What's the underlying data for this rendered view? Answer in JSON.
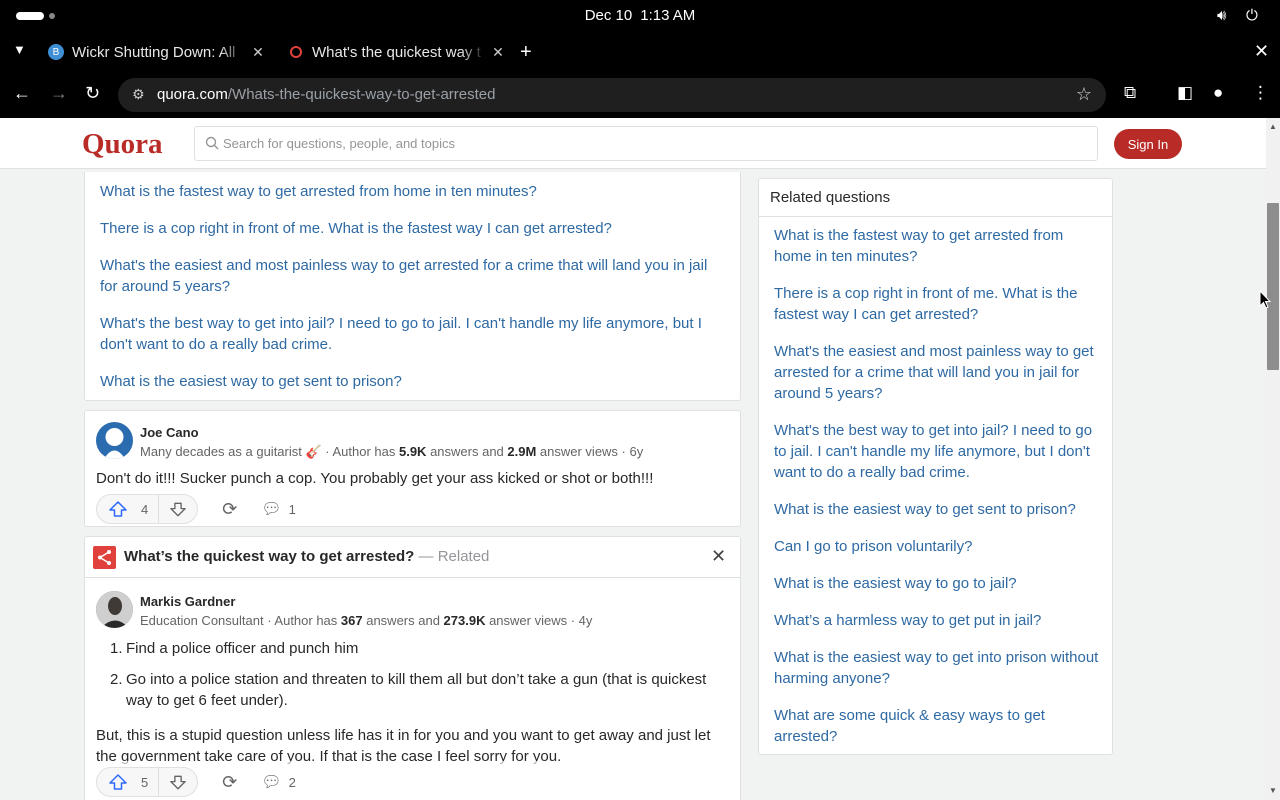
{
  "os": {
    "date": "Dec 10",
    "time": "1:13 AM"
  },
  "tabs": [
    {
      "title": "Wickr Shutting Down: All",
      "favicon": "wickr-favicon"
    },
    {
      "title": "What's the quickest way t",
      "favicon": "quora-favicon"
    }
  ],
  "address": {
    "domain": "quora.com",
    "path": "/Whats-the-quickest-way-to-get-arrested"
  },
  "header": {
    "logo": "Quora",
    "search_placeholder": "Search for questions, people, and topics",
    "signin": "Sign In"
  },
  "related_list": [
    "What is the fastest way to get arrested from home in ten minutes?",
    "There is a cop right in front of me. What is the fastest way I can get arrested?",
    "What's the easiest and most painless way to get arrested for a crime that will land you in jail for around 5 years?",
    "What's the best way to get into jail? I need to go to jail. I can't handle my life anymore, but I don't want to do a really bad crime.",
    "What is the easiest way to get sent to prison?"
  ],
  "answer1": {
    "author": "Joe Cano",
    "cred_prefix": "Many decades as a guitarist 🎸 · Author has ",
    "answers": "5.9K",
    "cred_mid": " answers and ",
    "views": "2.9M",
    "cred_suffix": " answer views · 6y",
    "text": "Don't do it!!! Sucker punch a cop. You probably get your ass kicked or shot or both!!!",
    "upvotes": "4",
    "comments": "1"
  },
  "answer2": {
    "related_title": "What’s the quickest way to get arrested?",
    "related_suffix": " — Related",
    "author": "Markis Gardner",
    "cred_prefix": "Education Consultant · Author has ",
    "answers": "367",
    "cred_mid": " answers and ",
    "views": "273.9K",
    "cred_suffix": " answer views · 4y",
    "list": [
      {
        "num": "1.",
        "text": "Find a police officer and punch him"
      },
      {
        "num": "2.",
        "text": "Go into a police station and threaten to kill them all but don’t take a gun (that is quickest way to get 6 feet under)."
      }
    ],
    "paragraph": "But, this is a stupid question unless life has it in for you and you want to get away and just let the government take care of you. If that is the case I feel sorry for you.",
    "upvotes": "5",
    "comments": "2"
  },
  "sidebar": {
    "title": "Related questions",
    "items": [
      "What is the fastest way to get arrested from home in ten minutes?",
      "There is a cop right in front of me. What is the fastest way I can get arrested?",
      "What's the easiest and most painless way to get arrested for a crime that will land you in jail for around 5 years?",
      "What's the best way to get into jail? I need to go to jail. I can't handle my life anymore, but I don't want to do a really bad crime.",
      "What is the easiest way to get sent to prison?",
      "Can I go to prison voluntarily?",
      "What is the easiest way to go to jail?",
      "What’s a harmless way to get put in jail?",
      "What is the easiest way to get into prison without harming anyone?",
      "What are some quick & easy ways to get arrested?"
    ]
  },
  "colors": {
    "brand": "#b92b27",
    "link": "#2e69a3"
  }
}
